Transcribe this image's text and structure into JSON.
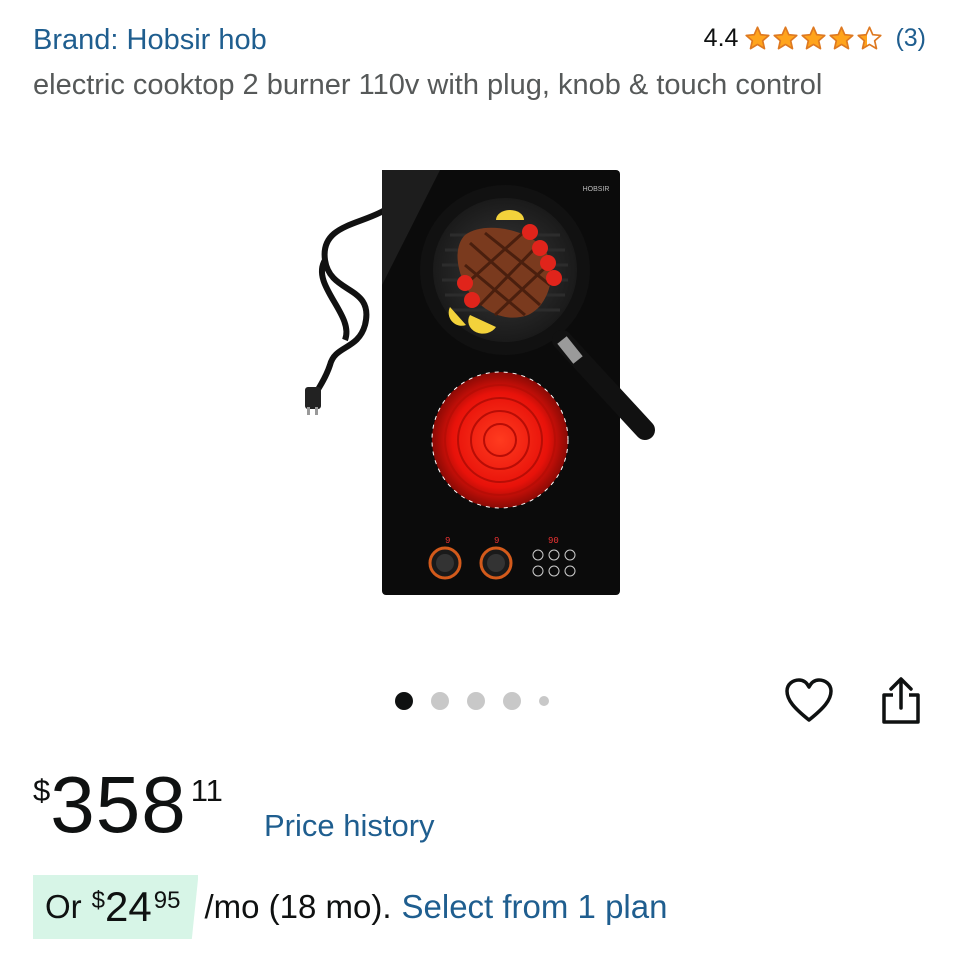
{
  "product": {
    "brand": "Brand: Hobsir hob",
    "title": "electric cooktop 2 burner 110v with plug, knob & touch control",
    "rating": {
      "value": "4.4",
      "stars": 4.4,
      "count": "(3)"
    },
    "image": {
      "logo_text": "HOBSIR",
      "left_readout": "9",
      "right_readout": "9",
      "timer_readout": "90"
    },
    "gallery": {
      "count": 5,
      "active_index": 0
    }
  },
  "actions": {
    "wishlist_icon": "heart-outline-icon",
    "share_icon": "share-icon"
  },
  "price": {
    "currency": "$",
    "whole": "358",
    "fraction": "11",
    "history_link": "Price history"
  },
  "installment": {
    "prefix": "Or",
    "currency": "$",
    "whole": "24",
    "fraction": "95",
    "terms": "/mo (18 mo).",
    "link": "Select from 1 plan"
  },
  "colors": {
    "link_blue": "#1f5e8f",
    "star_orange": "#ffa41c",
    "badge_green": "#d7f5e7"
  }
}
